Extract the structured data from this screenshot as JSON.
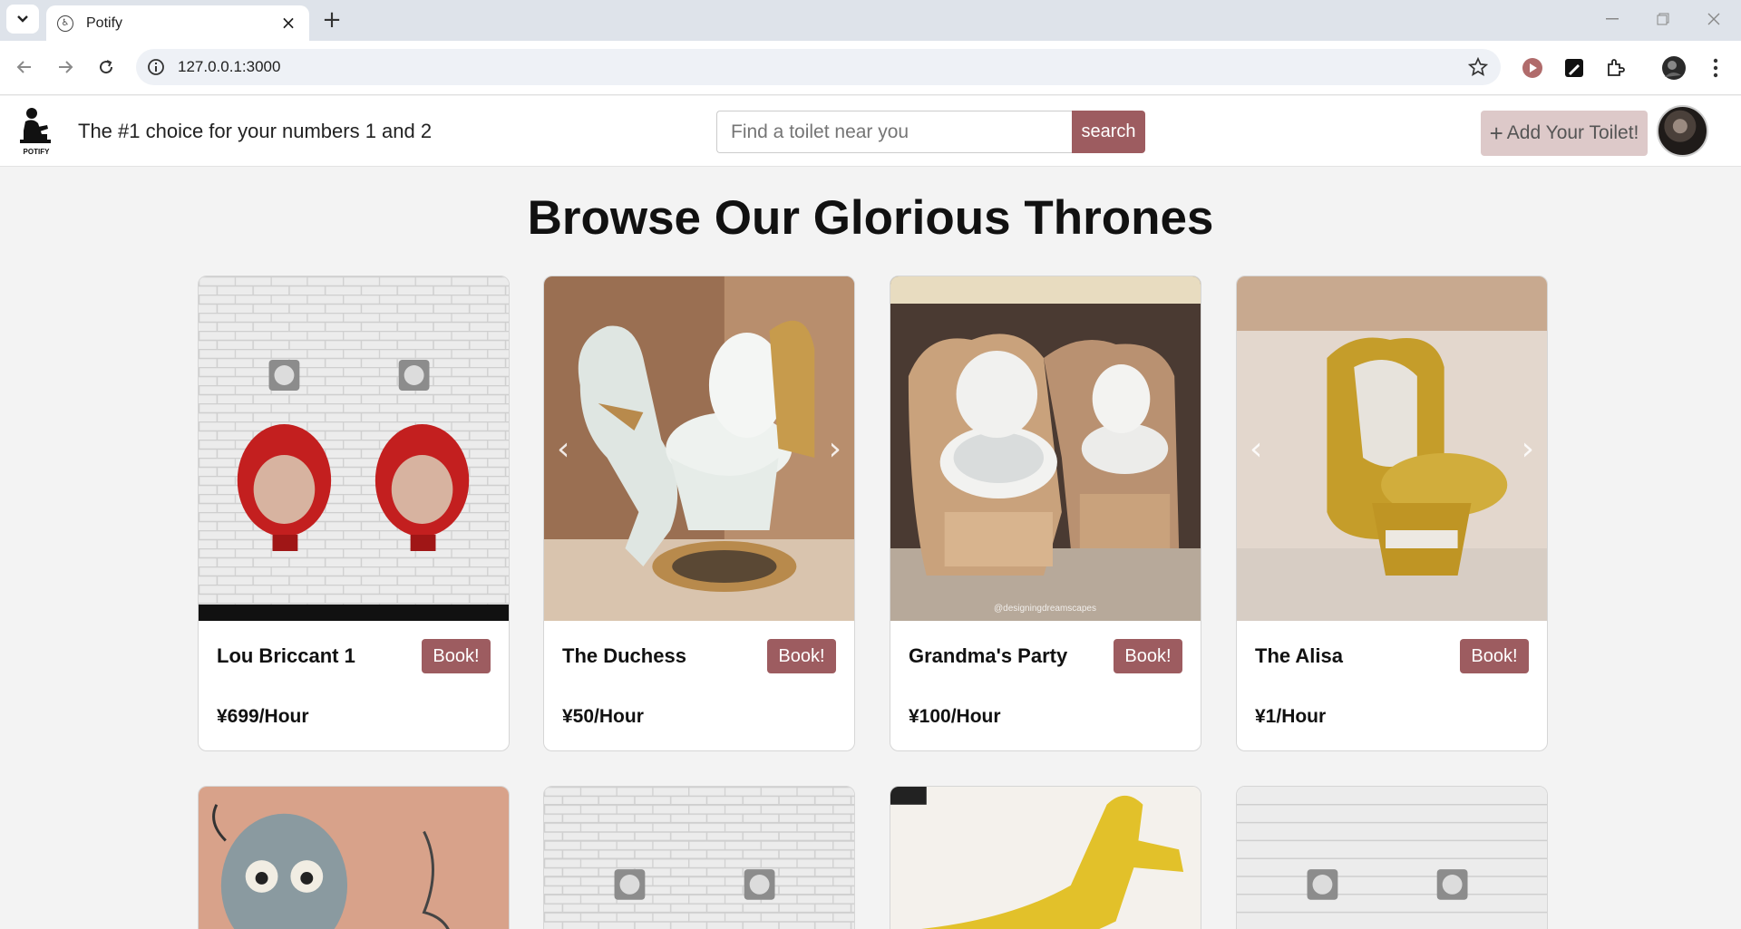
{
  "browser": {
    "tab_title": "Potify",
    "url": "127.0.0.1:3000"
  },
  "header": {
    "logo_text": "POTIFY",
    "tagline": "The #1 choice for your numbers 1 and 2",
    "search_placeholder": "Find a toilet near you",
    "search_label": "search",
    "add_label": "Add Your Toilet!"
  },
  "main": {
    "title": "Browse Our Glorious Thrones",
    "cards": [
      {
        "name": "Lou Briccant 1",
        "price": "¥699/Hour",
        "book_label": "Book!"
      },
      {
        "name": "The Duchess",
        "price": "¥50/Hour",
        "book_label": "Book!"
      },
      {
        "name": "Grandma's Party",
        "price": "¥100/Hour",
        "book_label": "Book!"
      },
      {
        "name": "The Alisa",
        "price": "¥1/Hour",
        "book_label": "Book!"
      }
    ],
    "watermark": "@designingdreamscapes"
  },
  "colors": {
    "accent": "#9d5c60",
    "accent_light": "#ddc9c9",
    "page_bg": "#f3f3f3"
  },
  "icons": [
    "chevron-down-icon",
    "favicon-icon",
    "close-icon",
    "plus-icon",
    "minimize-icon",
    "restore-icon",
    "back-icon",
    "forward-icon",
    "reload-icon",
    "info-icon",
    "star-icon",
    "extension-icon",
    "profile-icon",
    "kebab-menu-icon",
    "arrow-prev-icon",
    "arrow-next-icon"
  ]
}
